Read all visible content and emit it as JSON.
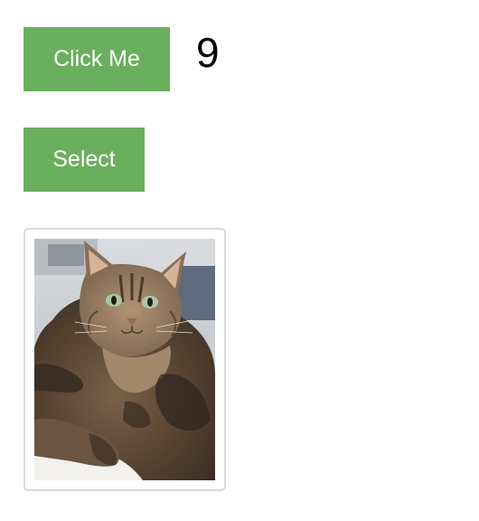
{
  "buttons": {
    "click_label": "Click Me",
    "select_label": "Select"
  },
  "counter": {
    "value": "9"
  },
  "image": {
    "subject": "cat",
    "colors": {
      "button": "#6aaf5e",
      "card_border": "#dadada"
    }
  }
}
